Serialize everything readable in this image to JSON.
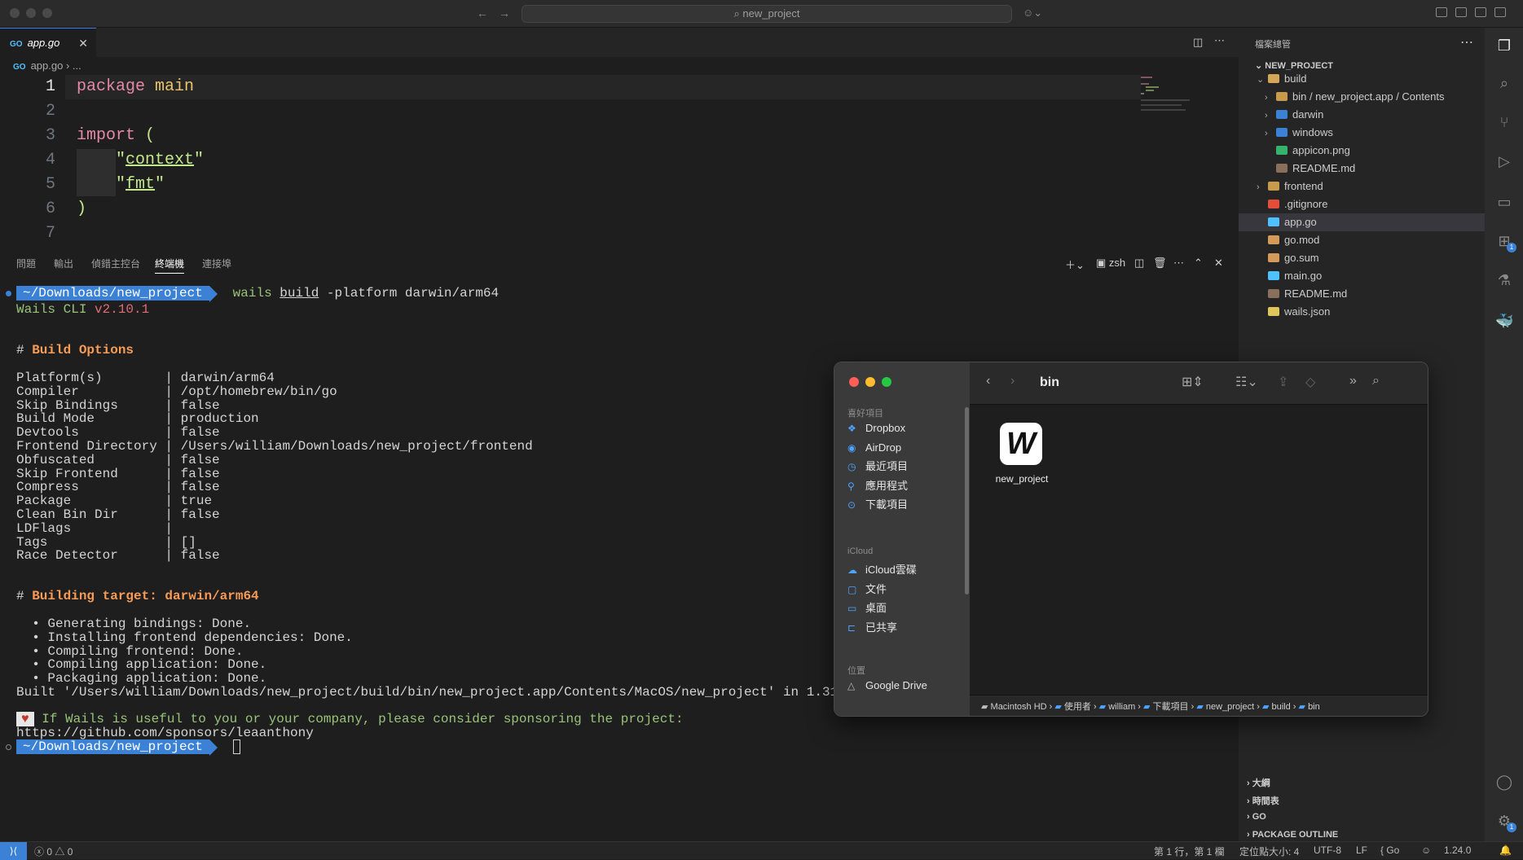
{
  "window": {
    "search_text": "new_project"
  },
  "editor": {
    "tab_label": "app.go",
    "breadcrumb_file": "app.go",
    "breadcrumb_more": "...",
    "lines": [
      {
        "n": "1",
        "parts": [
          [
            "kw",
            "package"
          ],
          [
            "",
            ""
          ],
          [
            "pk",
            " main"
          ]
        ]
      },
      {
        "n": "2",
        "parts": []
      },
      {
        "n": "3",
        "parts": [
          [
            "kw",
            "import"
          ],
          [
            "sq",
            " ("
          ]
        ]
      },
      {
        "n": "4",
        "parts": [
          [
            "",
            "    "
          ],
          [
            "sq",
            "\""
          ],
          [
            "st",
            "context"
          ],
          [
            "sq",
            "\""
          ]
        ]
      },
      {
        "n": "5",
        "parts": [
          [
            "",
            "    "
          ],
          [
            "sq",
            "\""
          ],
          [
            "st",
            "fmt"
          ],
          [
            "sq",
            "\""
          ]
        ]
      },
      {
        "n": "6",
        "parts": [
          [
            "sq",
            ")"
          ]
        ]
      },
      {
        "n": "7",
        "parts": []
      }
    ]
  },
  "panel": {
    "tabs": [
      "問題",
      "輸出",
      "偵錯主控台",
      "終端機",
      "連接埠"
    ],
    "active_tab": "終端機",
    "shell": "zsh"
  },
  "terminal": {
    "prompt": "~/Downloads/new_project",
    "command_name": "wails",
    "command_sub": "build",
    "command_args": " -platform darwin/arm64",
    "cli_label": "Wails CLI ",
    "cli_version": "v2.10.1",
    "build_options_header": "Build Options",
    "options": [
      [
        "Platform(s)",
        "darwin/arm64"
      ],
      [
        "Compiler",
        "/opt/homebrew/bin/go"
      ],
      [
        "Skip Bindings",
        "false"
      ],
      [
        "Build Mode",
        "production"
      ],
      [
        "Devtools",
        "false"
      ],
      [
        "Frontend Directory",
        "/Users/william/Downloads/new_project/frontend"
      ],
      [
        "Obfuscated",
        "false"
      ],
      [
        "Skip Frontend",
        "false"
      ],
      [
        "Compress",
        "false"
      ],
      [
        "Package",
        "true"
      ],
      [
        "Clean Bin Dir",
        "false"
      ],
      [
        "LDFlags",
        ""
      ],
      [
        "Tags",
        "[]"
      ],
      [
        "Race Detector",
        "false"
      ]
    ],
    "building_header": "Building target: darwin/arm64",
    "steps": [
      "Generating bindings: Done.",
      "Installing frontend dependencies: Done.",
      "Compiling frontend: Done.",
      "Compiling application: Done.",
      "Packaging application: Done."
    ],
    "built_line": "Built '/Users/william/Downloads/new_project/build/bin/new_project.app/Contents/MacOS/new_project' in 1.319s.",
    "heart": "♥",
    "sponsor_line": " If Wails is useful to you or your company, please consider sponsoring the project:",
    "sponsor_url": "https://github.com/sponsors/leaanthony"
  },
  "explorer": {
    "title": "檔案總管",
    "root": "NEW_PROJECT",
    "items": [
      {
        "label": "build",
        "depth": 1,
        "chevron": "⌄",
        "icon": "folder-open"
      },
      {
        "label": "bin / new_project.app / Contents",
        "depth": 2,
        "chevron": "›",
        "icon": "folder"
      },
      {
        "label": "darwin",
        "depth": 2,
        "chevron": "›",
        "icon": "folder-blue"
      },
      {
        "label": "windows",
        "depth": 2,
        "chevron": "›",
        "icon": "folder-blue"
      },
      {
        "label": "appicon.png",
        "depth": 2,
        "chevron": "",
        "icon": "image"
      },
      {
        "label": "README.md",
        "depth": 2,
        "chevron": "",
        "icon": "markdown"
      },
      {
        "label": "frontend",
        "depth": 1,
        "chevron": "›",
        "icon": "folder"
      },
      {
        "label": ".gitignore",
        "depth": 1,
        "chevron": "",
        "icon": "git"
      },
      {
        "label": "app.go",
        "depth": 1,
        "chevron": "",
        "icon": "go"
      },
      {
        "label": "go.mod",
        "depth": 1,
        "chevron": "",
        "icon": "gomod"
      },
      {
        "label": "go.sum",
        "depth": 1,
        "chevron": "",
        "icon": "gomod"
      },
      {
        "label": "main.go",
        "depth": 1,
        "chevron": "",
        "icon": "go"
      },
      {
        "label": "README.md",
        "depth": 1,
        "chevron": "",
        "icon": "markdown"
      },
      {
        "label": "wails.json",
        "depth": 1,
        "chevron": "",
        "icon": "json"
      }
    ],
    "sections": [
      "大綱",
      "時間表",
      "GO",
      "PACKAGE OUTLINE"
    ]
  },
  "finder": {
    "title": "bin",
    "favorites_header": "喜好項目",
    "favorites": [
      "Dropbox",
      "AirDrop",
      "最近項目",
      "應用程式",
      "下載項目"
    ],
    "icloud_header": "iCloud",
    "icloud": [
      "iCloud雲碟",
      "文件",
      "桌面",
      "已共享"
    ],
    "locations_header": "位置",
    "locations": [
      "Google Drive"
    ],
    "file_label": "new_project",
    "app_letter": "W",
    "path": [
      "Macintosh HD",
      "使用者",
      "william",
      "下載項目",
      "new_project",
      "build",
      "bin"
    ]
  },
  "statusbar": {
    "errors": "0",
    "warnings": "0",
    "position": "第 1 行，第 1 欄",
    "indent": "定位點大小: 4",
    "encoding": "UTF-8",
    "eol": "LF",
    "language": "Go",
    "go_version": "1.24.0"
  },
  "activity_badges": {
    "extensions": "1",
    "settings": "1"
  },
  "colors": {
    "accent": "#3b82d6",
    "header": "#f79b57",
    "string": "#c3e88d",
    "keyword": "#e48aa8"
  }
}
